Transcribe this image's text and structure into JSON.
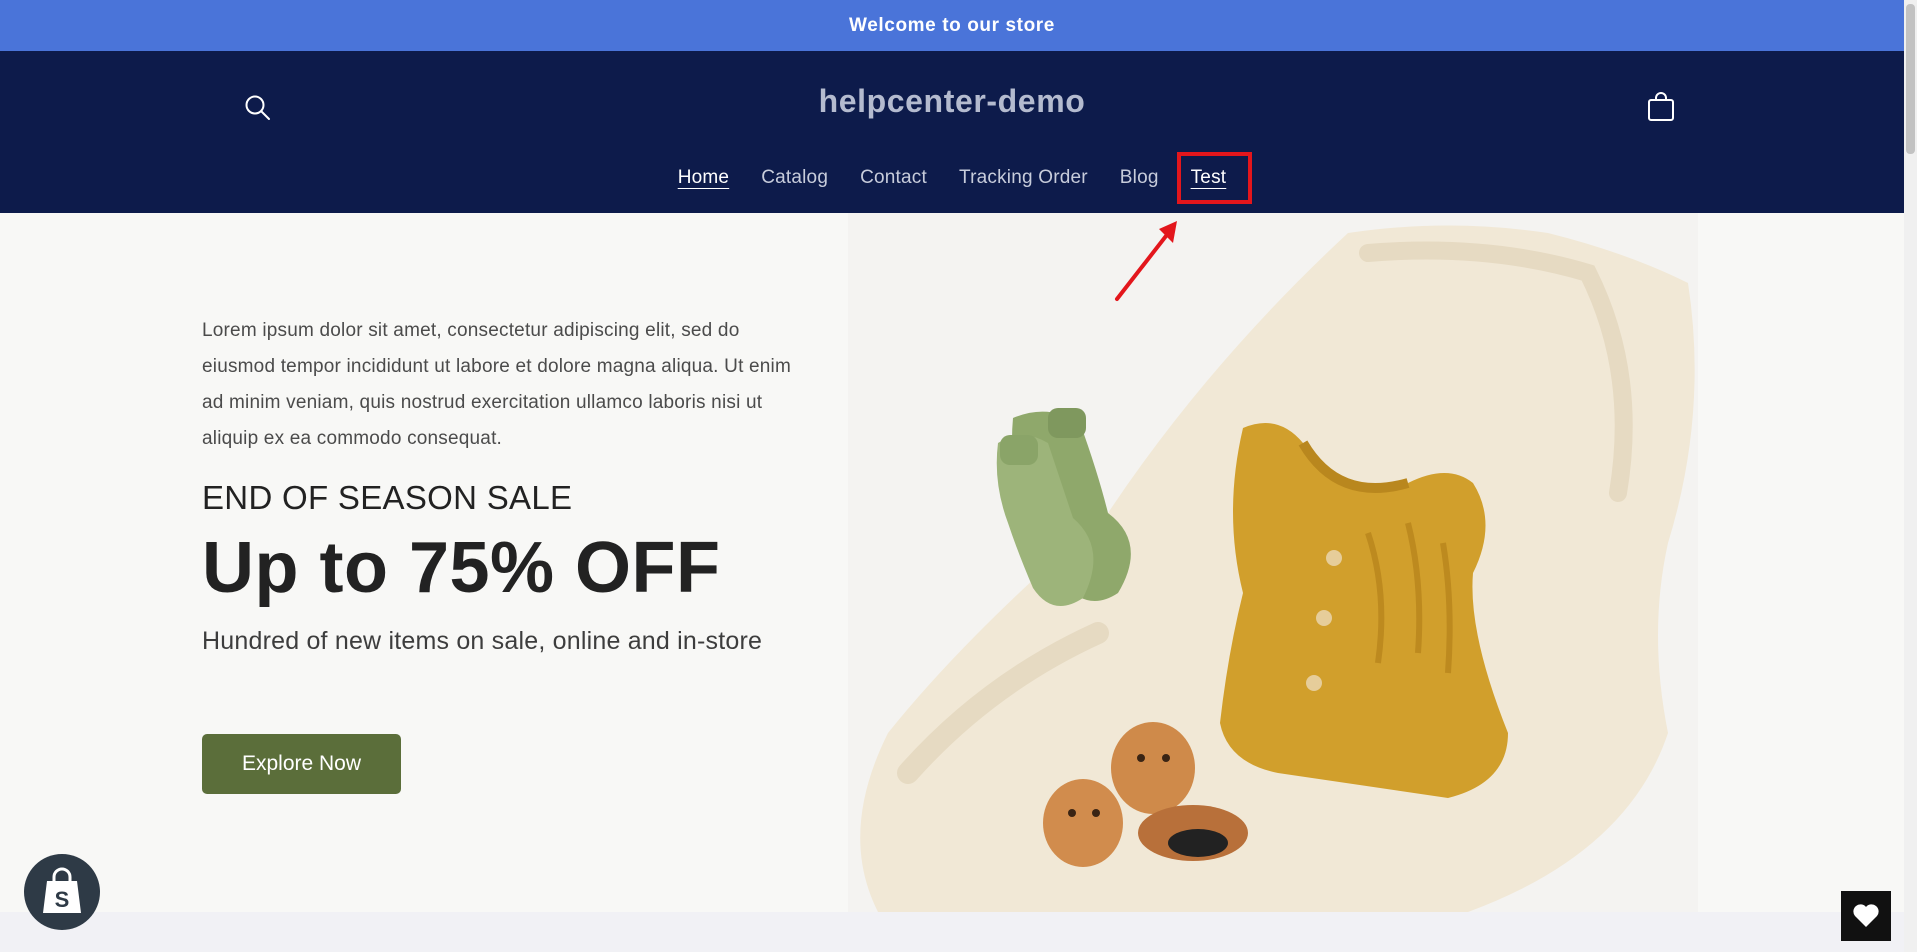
{
  "announcement": {
    "text": "Welcome to our store"
  },
  "header": {
    "store_name": "helpcenter-demo",
    "icons": {
      "search": "search-icon",
      "cart": "cart-icon"
    }
  },
  "nav": {
    "items": [
      {
        "label": "Home",
        "state": "active"
      },
      {
        "label": "Catalog"
      },
      {
        "label": "Contact"
      },
      {
        "label": "Tracking Order"
      },
      {
        "label": "Blog"
      },
      {
        "label": "Test",
        "highlighted": true
      }
    ]
  },
  "hero": {
    "description": "Lorem ipsum dolor sit amet, consectetur adipiscing elit, sed do eiusmod tempor incididunt ut labore et dolore magna aliqua. Ut enim ad minim veniam, quis nostrud exercitation ullamco laboris nisi ut aliquip ex ea commodo consequat.",
    "eyebrow": "END OF SEASON SALE",
    "heading": "Up to 75% OFF",
    "subheading": "Hundred of new items on sale, online and in-store",
    "cta_label": "Explore Now"
  },
  "widgets": {
    "shopify_icon": "shopify-bag-icon",
    "wishlist_icon": "heart-icon"
  },
  "colors": {
    "announcement_bg": "#4a74d9",
    "header_bg": "#0d1b4b",
    "cta_bg": "#5b6e3a",
    "annotation": "#e3161c"
  }
}
